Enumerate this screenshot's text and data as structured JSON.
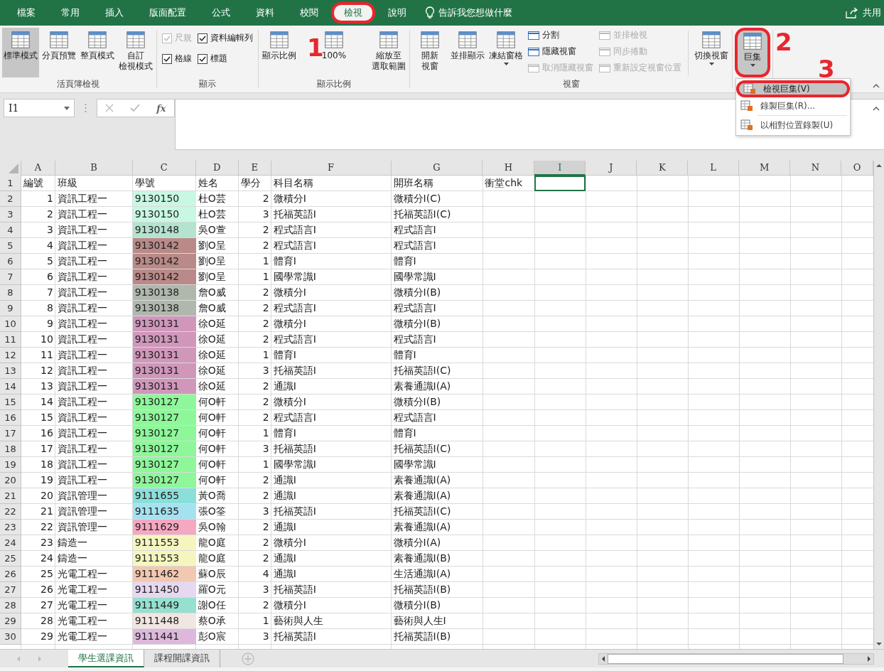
{
  "tabs": [
    {
      "label": "檔案",
      "selected": false,
      "highlighted": false
    },
    {
      "label": "常用",
      "selected": false,
      "highlighted": false
    },
    {
      "label": "插入",
      "selected": false,
      "highlighted": false
    },
    {
      "label": "版面配置",
      "selected": false,
      "highlighted": false
    },
    {
      "label": "公式",
      "selected": false,
      "highlighted": false
    },
    {
      "label": "資料",
      "selected": false,
      "highlighted": false
    },
    {
      "label": "校閱",
      "selected": false,
      "highlighted": false
    },
    {
      "label": "檢視",
      "selected": true,
      "highlighted": true
    },
    {
      "label": "說明",
      "selected": false,
      "highlighted": false
    }
  ],
  "tell_me": "告訴我您想做什麼",
  "share": "共用",
  "groups": [
    {
      "label": "活頁簿檢視",
      "items": [
        {
          "kind": "large",
          "label": "標準模式",
          "selected": true,
          "dropdown": false,
          "highlighted": false
        },
        {
          "kind": "large",
          "label": "分頁預覽",
          "selected": false,
          "dropdown": false,
          "highlighted": false
        },
        {
          "kind": "large",
          "label": "整頁模式",
          "selected": false,
          "dropdown": false,
          "highlighted": false
        },
        {
          "kind": "large",
          "lines": [
            "自訂",
            "檢視模式"
          ],
          "selected": false,
          "dropdown": false,
          "highlighted": false
        }
      ]
    },
    {
      "label": "顯示",
      "items": [
        {
          "kind": "checks",
          "entries": [
            {
              "label": "尺規",
              "checked": true,
              "disabled": true
            },
            {
              "label": "資料編輯列",
              "checked": true,
              "disabled": false
            },
            {
              "label": "格線",
              "checked": true,
              "disabled": false
            },
            {
              "label": "標題",
              "checked": true,
              "disabled": false
            }
          ]
        }
      ]
    },
    {
      "label": "顯示比例",
      "items": [
        {
          "kind": "large",
          "label": "顯示比例",
          "selected": false,
          "dropdown": false,
          "highlighted": false
        },
        {
          "kind": "large",
          "label": "100%",
          "selected": false,
          "dropdown": false,
          "highlighted": false
        },
        {
          "kind": "large",
          "lines": [
            "縮放至",
            "選取範圍"
          ],
          "selected": false,
          "dropdown": false,
          "highlighted": false
        }
      ]
    },
    {
      "label": "視窗",
      "items": [
        {
          "kind": "large",
          "lines": [
            "開新",
            "視窗"
          ],
          "selected": false,
          "dropdown": false,
          "highlighted": false
        },
        {
          "kind": "large",
          "label": "並排顯示",
          "selected": false,
          "dropdown": false,
          "highlighted": false
        },
        {
          "kind": "large",
          "label": "凍結窗格",
          "selected": false,
          "dropdown": true,
          "highlighted": false
        },
        {
          "kind": "stack",
          "entries": [
            {
              "label": "分割",
              "disabled": false
            },
            {
              "label": "隱藏視窗",
              "disabled": false
            },
            {
              "label": "取消隱藏視窗",
              "disabled": true
            }
          ]
        },
        {
          "kind": "stack",
          "entries": [
            {
              "label": "並排檢視",
              "disabled": true
            },
            {
              "label": "同步捲動",
              "disabled": true
            },
            {
              "label": "重新設定視窗位置",
              "disabled": true
            }
          ]
        },
        {
          "kind": "sep"
        },
        {
          "kind": "large",
          "label": "切換視窗",
          "selected": false,
          "dropdown": true,
          "highlighted": false
        }
      ]
    },
    {
      "items": [
        {
          "kind": "large",
          "label": "巨集",
          "selected": true,
          "dropdown": true,
          "highlighted": true
        }
      ]
    }
  ],
  "macro_menu": [
    {
      "label": "檢視巨集(V)",
      "selected": true,
      "highlighted": true
    },
    {
      "label": "錄製巨集(R)...",
      "selected": false,
      "highlighted": false
    },
    {
      "label": "以相對位置錄製(U)",
      "selected": false,
      "highlighted": false
    }
  ],
  "callouts": [
    "1",
    "2",
    "3"
  ],
  "name_box": "I1",
  "fx": "fx",
  "columns": [
    {
      "label": "A",
      "selected": false
    },
    {
      "label": "B",
      "selected": false
    },
    {
      "label": "C",
      "selected": false
    },
    {
      "label": "D",
      "selected": false
    },
    {
      "label": "E",
      "selected": false
    },
    {
      "label": "F",
      "selected": false
    },
    {
      "label": "G",
      "selected": false
    },
    {
      "label": "H",
      "selected": false
    },
    {
      "label": "I",
      "selected": true
    },
    {
      "label": "J",
      "selected": false
    },
    {
      "label": "K",
      "selected": false
    },
    {
      "label": "L",
      "selected": false
    },
    {
      "label": "M",
      "selected": false
    },
    {
      "label": "N",
      "selected": false
    },
    {
      "label": "O",
      "selected": false
    }
  ],
  "rows": [
    {
      "number": "1",
      "cells": [
        "編號",
        "班級",
        "學號",
        "姓名",
        "學分",
        "科目名稱",
        "開班名稱",
        "衝堂chk"
      ]
    },
    {
      "number": "2",
      "color": "#c8f7e3",
      "cells": [
        "1",
        "資訊工程一",
        "9130150",
        "杜O芸",
        "2",
        "微積分Ⅰ",
        "微積分Ⅰ(C)"
      ]
    },
    {
      "number": "3",
      "color": "#c8f7e3",
      "cells": [
        "2",
        "資訊工程一",
        "9130150",
        "杜O芸",
        "3",
        "托福英語Ⅰ",
        "托福英語Ⅰ(C)"
      ]
    },
    {
      "number": "4",
      "color": "#b4e3cf",
      "cells": [
        "3",
        "資訊工程一",
        "9130148",
        "吳O萱",
        "2",
        "程式語言Ⅰ",
        "程式語言Ⅰ"
      ]
    },
    {
      "number": "5",
      "color": "#b98a88",
      "cells": [
        "4",
        "資訊工程一",
        "9130142",
        "劉O呈",
        "2",
        "程式語言Ⅰ",
        "程式語言Ⅰ"
      ]
    },
    {
      "number": "6",
      "color": "#b98a88",
      "cells": [
        "5",
        "資訊工程一",
        "9130142",
        "劉O呈",
        "1",
        "體育Ⅰ",
        "體育Ⅰ"
      ]
    },
    {
      "number": "7",
      "color": "#b98a88",
      "cells": [
        "6",
        "資訊工程一",
        "9130142",
        "劉O呈",
        "1",
        "國學常識Ⅰ",
        "國學常識Ⅰ"
      ]
    },
    {
      "number": "8",
      "color": "#b0b8ae",
      "cells": [
        "7",
        "資訊工程一",
        "9130138",
        "詹O威",
        "2",
        "微積分Ⅰ",
        "微積分Ⅰ(B)"
      ]
    },
    {
      "number": "9",
      "color": "#b0b8ae",
      "cells": [
        "8",
        "資訊工程一",
        "9130138",
        "詹O威",
        "2",
        "程式語言Ⅰ",
        "程式語言Ⅰ"
      ]
    },
    {
      "number": "10",
      "color": "#d097bb",
      "cells": [
        "9",
        "資訊工程一",
        "9130131",
        "徐O延",
        "2",
        "微積分Ⅰ",
        "微積分Ⅰ(B)"
      ]
    },
    {
      "number": "11",
      "color": "#d097bb",
      "cells": [
        "10",
        "資訊工程一",
        "9130131",
        "徐O延",
        "2",
        "程式語言Ⅰ",
        "程式語言Ⅰ"
      ]
    },
    {
      "number": "12",
      "color": "#d097bb",
      "cells": [
        "11",
        "資訊工程一",
        "9130131",
        "徐O延",
        "1",
        "體育Ⅰ",
        "體育Ⅰ"
      ]
    },
    {
      "number": "13",
      "color": "#d097bb",
      "cells": [
        "12",
        "資訊工程一",
        "9130131",
        "徐O延",
        "3",
        "托福英語Ⅰ",
        "托福英語Ⅰ(C)"
      ]
    },
    {
      "number": "14",
      "color": "#d097bb",
      "cells": [
        "13",
        "資訊工程一",
        "9130131",
        "徐O延",
        "2",
        "通識Ⅰ",
        "素養通識Ⅰ(A)"
      ]
    },
    {
      "number": "15",
      "color": "#8ef79a",
      "cells": [
        "14",
        "資訊工程一",
        "9130127",
        "何O軒",
        "2",
        "微積分Ⅰ",
        "微積分Ⅰ(B)"
      ]
    },
    {
      "number": "16",
      "color": "#8ef79a",
      "cells": [
        "15",
        "資訊工程一",
        "9130127",
        "何O軒",
        "2",
        "程式語言Ⅰ",
        "程式語言Ⅰ"
      ]
    },
    {
      "number": "17",
      "color": "#8ef79a",
      "cells": [
        "16",
        "資訊工程一",
        "9130127",
        "何O軒",
        "1",
        "體育Ⅰ",
        "體育Ⅰ"
      ]
    },
    {
      "number": "18",
      "color": "#8ef79a",
      "cells": [
        "17",
        "資訊工程一",
        "9130127",
        "何O軒",
        "3",
        "托福英語Ⅰ",
        "托福英語Ⅰ(C)"
      ]
    },
    {
      "number": "19",
      "color": "#8ef79a",
      "cells": [
        "18",
        "資訊工程一",
        "9130127",
        "何O軒",
        "1",
        "國學常識Ⅰ",
        "國學常識Ⅰ"
      ]
    },
    {
      "number": "20",
      "color": "#8ef79a",
      "cells": [
        "19",
        "資訊工程一",
        "9130127",
        "何O軒",
        "2",
        "通識Ⅰ",
        "素養通識Ⅰ(A)"
      ]
    },
    {
      "number": "21",
      "color": "#8ae0d8",
      "cells": [
        "20",
        "資訊管理一",
        "9111655",
        "黃O喬",
        "2",
        "通識Ⅰ",
        "素養通識Ⅰ(A)"
      ]
    },
    {
      "number": "22",
      "color": "#a5e2f0",
      "cells": [
        "21",
        "資訊管理一",
        "9111635",
        "張O筌",
        "3",
        "托福英語Ⅰ",
        "托福英語Ⅰ(C)"
      ]
    },
    {
      "number": "23",
      "color": "#f5a8c0",
      "cells": [
        "22",
        "資訊管理一",
        "9111629",
        "吳O翰",
        "2",
        "通識Ⅰ",
        "素養通識Ⅰ(A)"
      ]
    },
    {
      "number": "24",
      "color": "#f5f5c0",
      "cells": [
        "23",
        "鑄造一",
        "9111553",
        "龍O庭",
        "2",
        "微積分Ⅰ",
        "微積分Ⅰ(A)"
      ]
    },
    {
      "number": "25",
      "color": "#f5f5c0",
      "cells": [
        "24",
        "鑄造一",
        "9111553",
        "龍O庭",
        "2",
        "通識Ⅰ",
        "素養通識Ⅰ(B)"
      ]
    },
    {
      "number": "26",
      "color": "#f2c8b0",
      "cells": [
        "25",
        "光電工程一",
        "9111462",
        "蘇O辰",
        "4",
        "通識Ⅰ",
        "生活通識Ⅰ(A)"
      ]
    },
    {
      "number": "27",
      "color": "#e6d8f0",
      "cells": [
        "26",
        "光電工程一",
        "9111450",
        "羅O元",
        "3",
        "托福英語Ⅰ",
        "托福英語Ⅰ(B)"
      ]
    },
    {
      "number": "28",
      "color": "#96e0d0",
      "cells": [
        "27",
        "光電工程一",
        "9111449",
        "謝O任",
        "2",
        "微積分Ⅰ",
        "微積分Ⅰ(B)"
      ]
    },
    {
      "number": "29",
      "color": "#f2e6e2",
      "cells": [
        "28",
        "光電工程一",
        "9111448",
        "蔡O承",
        "1",
        "藝術與人生",
        "藝術與人生Ⅰ"
      ]
    },
    {
      "number": "30",
      "color": "#ddb8dc",
      "cells": [
        "29",
        "光電工程一",
        "9111441",
        "彭O宸",
        "3",
        "托福英語Ⅰ",
        "托福英語Ⅰ(B)"
      ]
    }
  ],
  "sheets": [
    {
      "label": "學生選課資訊",
      "selected": true
    },
    {
      "label": "課程開課資訊",
      "selected": false
    }
  ]
}
